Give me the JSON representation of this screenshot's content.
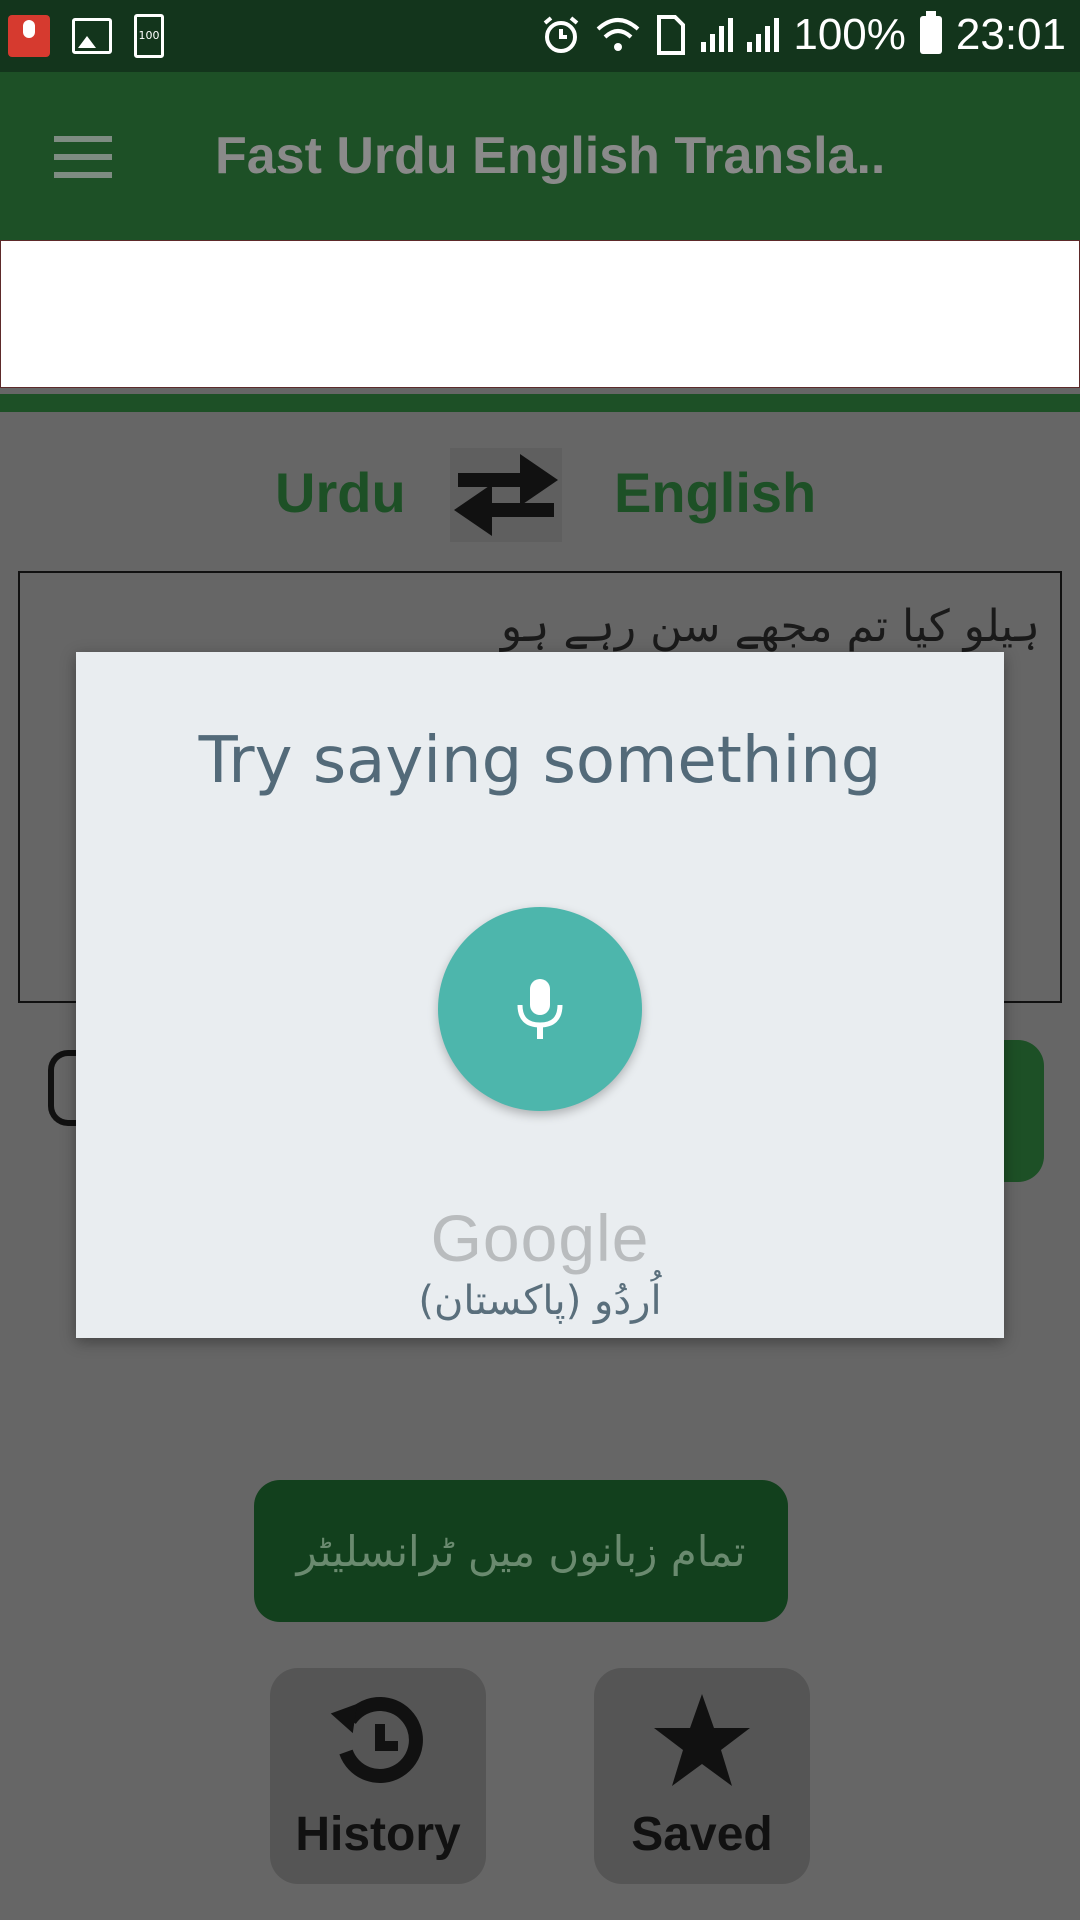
{
  "status_bar": {
    "battery_small_label": "100",
    "battery_percent": "100%",
    "time": "23:01"
  },
  "app_bar": {
    "title": "Fast Urdu English Transla.."
  },
  "languages": {
    "source": "Urdu",
    "target": "English"
  },
  "input": {
    "text": "ہیلو کیا تم مجھے سن رہے ہو"
  },
  "buttons": {
    "all_languages": "تمام زبانوں میں ٹرانسلیٹر",
    "history": "History",
    "saved": "Saved"
  },
  "voice_dialog": {
    "prompt": "Try saying something",
    "brand": "Google",
    "language": "اُردُو (پاکستان)"
  },
  "colors": {
    "status_bar_bg": "#13351c",
    "app_bar_bg": "#1d5026",
    "accent_green": "#1d5026",
    "mic_circle": "#4db6ac",
    "dialog_bg": "#e9edf0",
    "scrim": "#666666"
  },
  "icons": {
    "menu": "hamburger-menu-icon",
    "swap": "swap-arrows-icon",
    "mic": "microphone-icon",
    "history": "history-icon",
    "saved": "star-icon"
  }
}
